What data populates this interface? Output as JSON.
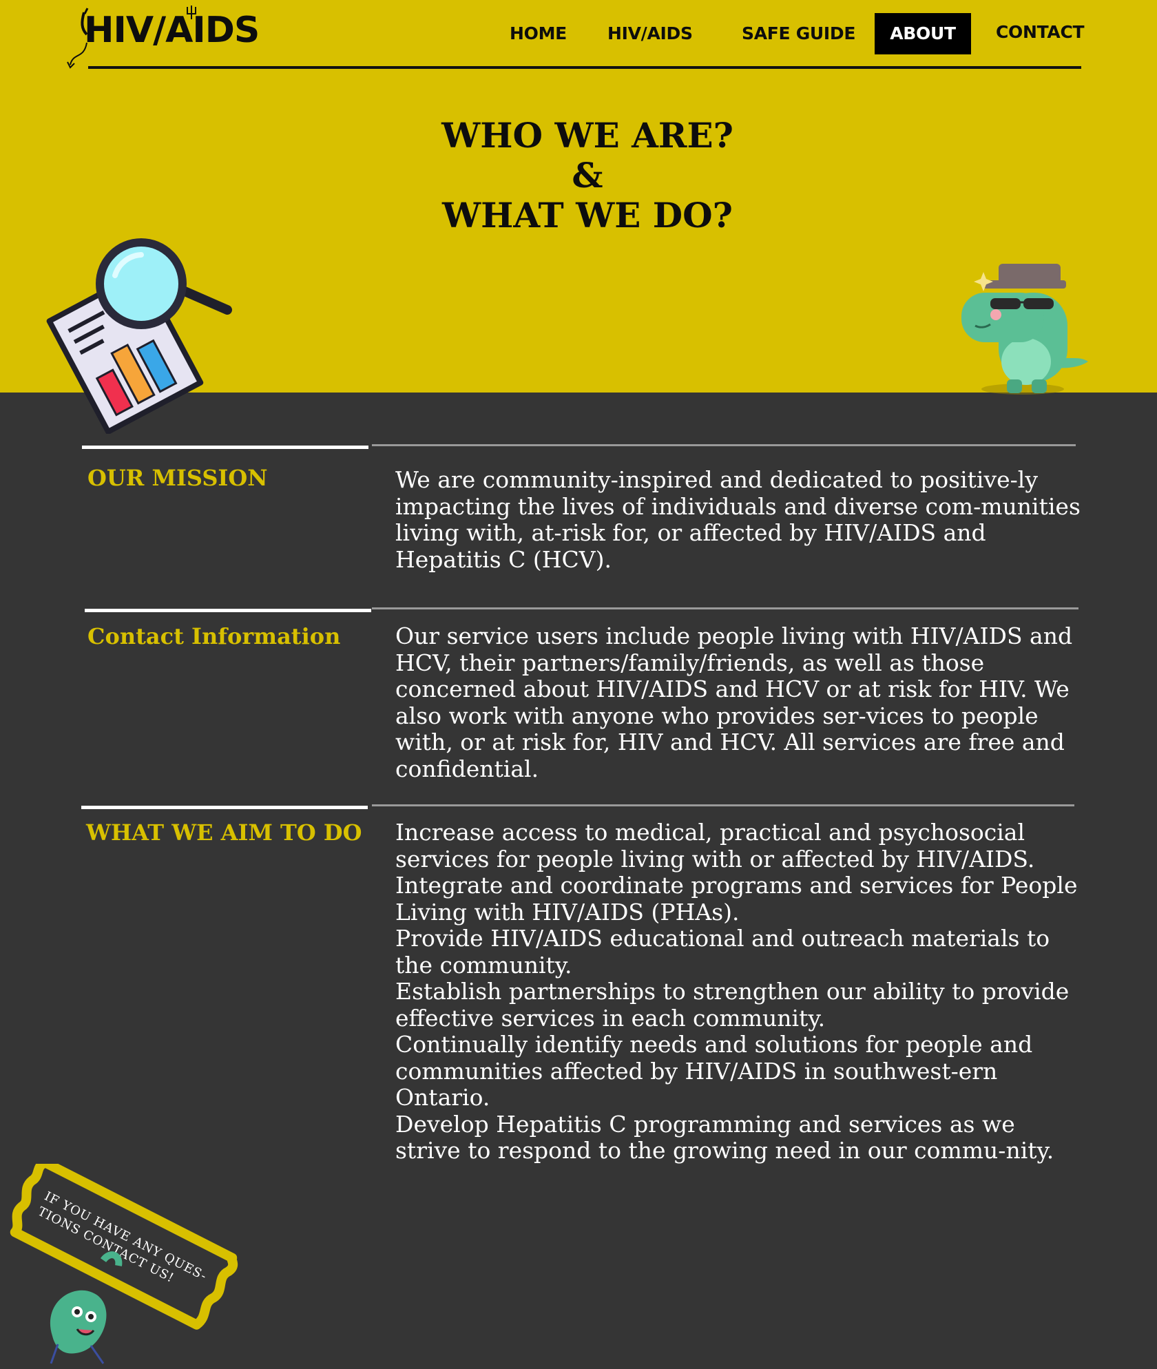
{
  "brand": {
    "logo_text": "HIV/AIDS"
  },
  "nav": {
    "items": [
      {
        "label": "HOME",
        "active": false
      },
      {
        "label": "HIV/AIDS",
        "active": false
      },
      {
        "label": "SAFE GUIDE",
        "active": false
      },
      {
        "label": "ABOUT",
        "active": true
      },
      {
        "label": "CONTACT",
        "active": false
      }
    ]
  },
  "hero": {
    "title_line1": "WHO WE ARE?",
    "title_line2": "&",
    "title_line3": "WHAT WE DO?"
  },
  "sections": [
    {
      "label": "OUR MISSION",
      "paragraphs": [
        "We are community-inspired and dedicated to positive-ly impacting the lives of individuals and diverse com-munities living with, at-risk for, or affected by HIV/AIDS and Hepatitis C (HCV)."
      ]
    },
    {
      "label": "Contact Information",
      "paragraphs": [
        "Our service users include people living with HIV/AIDS and HCV, their partners/family/friends, as well as those concerned about HIV/AIDS and HCV or at risk for HIV. We also work with anyone who provides ser-vices to people with, or at risk for, HIV and HCV. All services are free and confidential."
      ]
    },
    {
      "label": "WHAT WE AIM TO DO",
      "paragraphs": [
        "Increase access to medical, practical and psychosocial services for people living with or affected by HIV/AIDS.",
        "Integrate and coordinate programs and services for People Living with HIV/AIDS (PHAs).",
        "Provide HIV/AIDS educational and outreach materials to the community.",
        "Establish partnerships to strengthen our ability to provide effective services in each community.",
        "Continually identify needs and solutions for people and communities affected by HIV/AIDS in southwest-ern Ontario.",
        "Develop Hepatitis C programming and services as we strive to respond to the growing need in our commu-nity."
      ]
    }
  ],
  "cta": {
    "text": "IF YOU HAVE ANY QUES-TIONS CONTACT US!"
  },
  "colors": {
    "brand_yellow": "#d8c000",
    "dark_bg": "#353535",
    "text_white": "#ffffff",
    "black": "#000000"
  },
  "icons": [
    "devil-horns-icon",
    "trident-icon",
    "magnifier-report-illustration",
    "dino-mascot-illustration",
    "germ-mascot-illustration"
  ]
}
